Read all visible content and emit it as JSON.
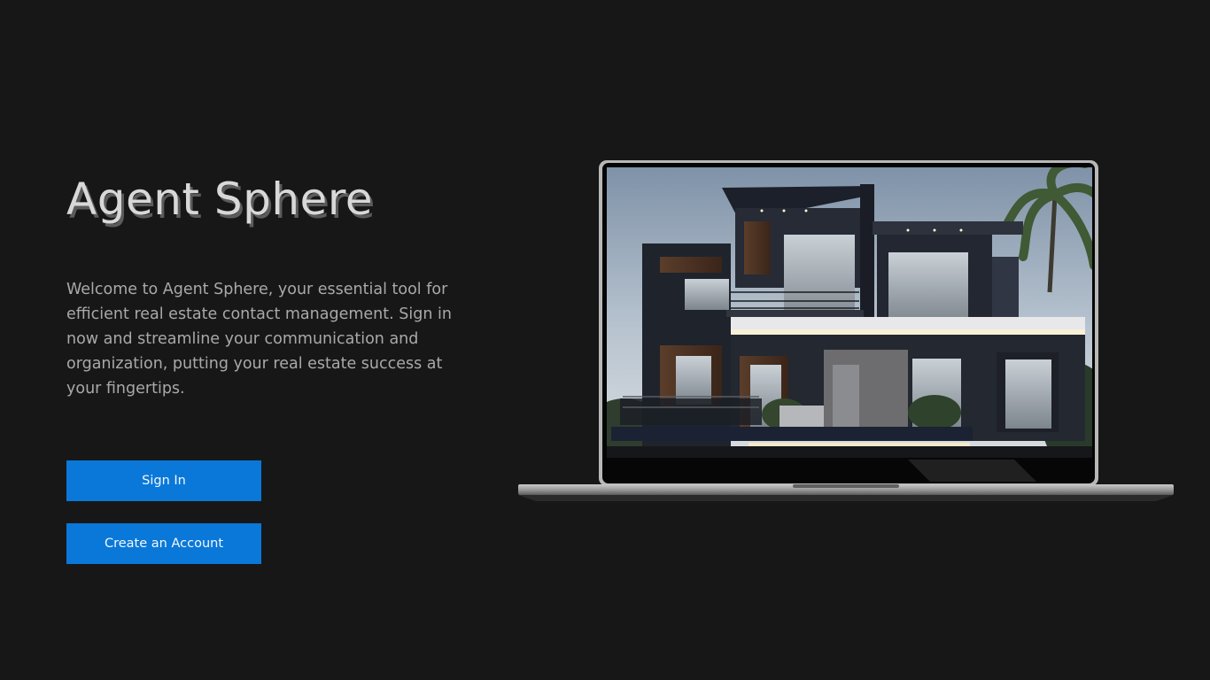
{
  "app": {
    "title": "Agent Sphere",
    "intro": "Welcome to Agent Sphere, your essential tool for efficient real estate contact management. Sign in now and streamline your communication and organization, putting your real estate success at your fingertips."
  },
  "actions": {
    "sign_in_label": "Sign In",
    "create_account_label": "Create an Account"
  },
  "colors": {
    "background": "#171718",
    "accent": "#0a78d8",
    "title": "#d8d8d8",
    "body_text": "#a9a9a9"
  },
  "illustration": {
    "icon": "laptop-with-modern-house-photo"
  }
}
